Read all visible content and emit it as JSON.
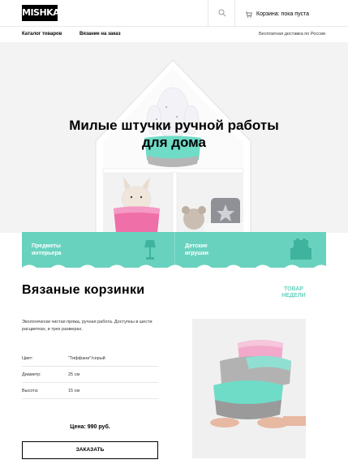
{
  "header": {
    "logo": "MISHKA",
    "cart_text": "Корзина: пока пуста"
  },
  "nav": {
    "catalog": "Каталог товаров",
    "knitting": "Вязание на заказ",
    "free_delivery": "Бесплатная доставка по России"
  },
  "hero": {
    "title_line1": "Милые штучки ручной работы",
    "title_line2": "для дома"
  },
  "categories": [
    {
      "label_line1": "Предметы",
      "label_line2": "интерьера",
      "icon": "lamp-icon"
    },
    {
      "label_line1": "Детские",
      "label_line2": "игрушки",
      "icon": "blocks-icon"
    }
  ],
  "product": {
    "title": "Вязаные корзинки",
    "badge_line1": "ТОВАР",
    "badge_line2": "НЕДЕЛИ",
    "description": "Экологически чистая пряжа, ручная работа. Доступны в шести расцветках, и трех размерах.",
    "specs": [
      {
        "key": "Цвет:",
        "value": "\"Тиффани\"/серый"
      },
      {
        "key": "Диаметр:",
        "value": "25 см"
      },
      {
        "key": "Высота:",
        "value": "15 см"
      }
    ],
    "price": "Цена: 990 руб.",
    "order_button": "ЗАКАЗАТЬ"
  },
  "colors": {
    "accent": "#68d2bf",
    "hero_bg": "#f3f3f3",
    "pink": "#ef6fa9",
    "grey": "#9a9a9a"
  }
}
